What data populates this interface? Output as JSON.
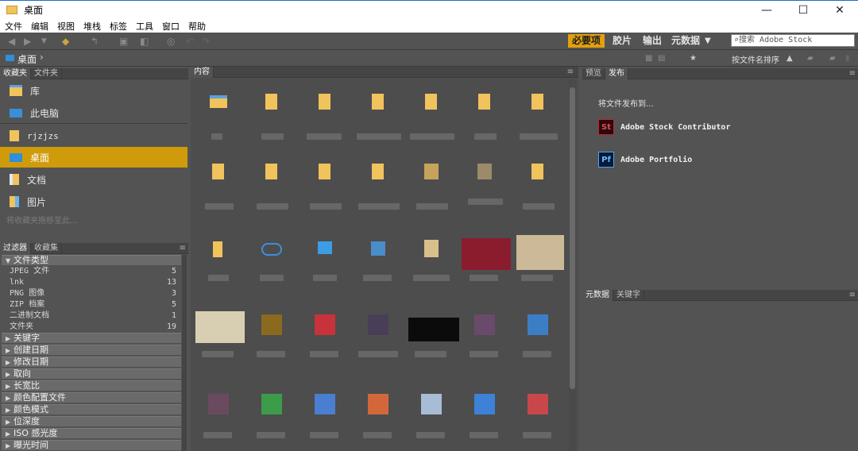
{
  "window": {
    "title": "桌面",
    "minimize": "—",
    "maximize": "☐",
    "close": "✕"
  },
  "menu": [
    "文件",
    "编辑",
    "视图",
    "堆栈",
    "标签",
    "工具",
    "窗口",
    "帮助"
  ],
  "workspaces": {
    "active": "必要项",
    "items": [
      "胶片",
      "输出",
      "元数据"
    ],
    "more": "▼"
  },
  "search": {
    "placeholder": "搜索 Adobe Stock"
  },
  "path": {
    "current": "桌面",
    "chevron": "›"
  },
  "sort": {
    "label": "按文件名排序"
  },
  "favorites_panel": {
    "tabs": [
      "收藏夹",
      "文件夹"
    ],
    "items": [
      {
        "label": "库",
        "icon": "library-folder-icon"
      },
      {
        "label": "此电脑",
        "icon": "computer-icon"
      },
      {
        "label": "rjzjzs",
        "icon": "folder-icon"
      },
      {
        "label": "桌面",
        "icon": "desktop-icon",
        "selected": true
      },
      {
        "label": "文档",
        "icon": "documents-icon"
      },
      {
        "label": "图片",
        "icon": "pictures-icon"
      }
    ],
    "hint": "将收藏夹拖移至此..."
  },
  "filter_panel": {
    "tabs": [
      "过滤器",
      "收藏集"
    ],
    "open_section": "文件类型",
    "file_types": [
      {
        "label": "JPEG 文件",
        "count": "5"
      },
      {
        "label": "lnk",
        "count": "13"
      },
      {
        "label": "PNG 图像",
        "count": "3"
      },
      {
        "label": "ZIP 档案",
        "count": "5"
      },
      {
        "label": "二进制文档",
        "count": "1"
      },
      {
        "label": "文件夹",
        "count": "19"
      }
    ],
    "sections": [
      "关键字",
      "创建日期",
      "修改日期",
      "取向",
      "长宽比",
      "颜色配置文件",
      "颜色模式",
      "位深度",
      "ISO 感光度",
      "曝光时间"
    ]
  },
  "content_panel": {
    "tab": "内容"
  },
  "publish_panel": {
    "tabs": [
      "预览",
      "发布"
    ],
    "heading": "将文件发布到...",
    "services": [
      {
        "logo": "St",
        "label": "Adobe Stock Contributor",
        "color": "#c9202f",
        "bg": "#2a0a0d"
      },
      {
        "logo": "Pf",
        "label": "Adobe Portfolio",
        "color": "#4aa3ff",
        "bg": "#061a33"
      }
    ]
  },
  "metadata_panel": {
    "tabs": [
      "元数据",
      "关键字"
    ]
  },
  "colors": {
    "accent": "#e2a00f",
    "selection": "#cf9b0b",
    "panel_bg": "#535353",
    "content_bg": "#4d4d4d"
  }
}
